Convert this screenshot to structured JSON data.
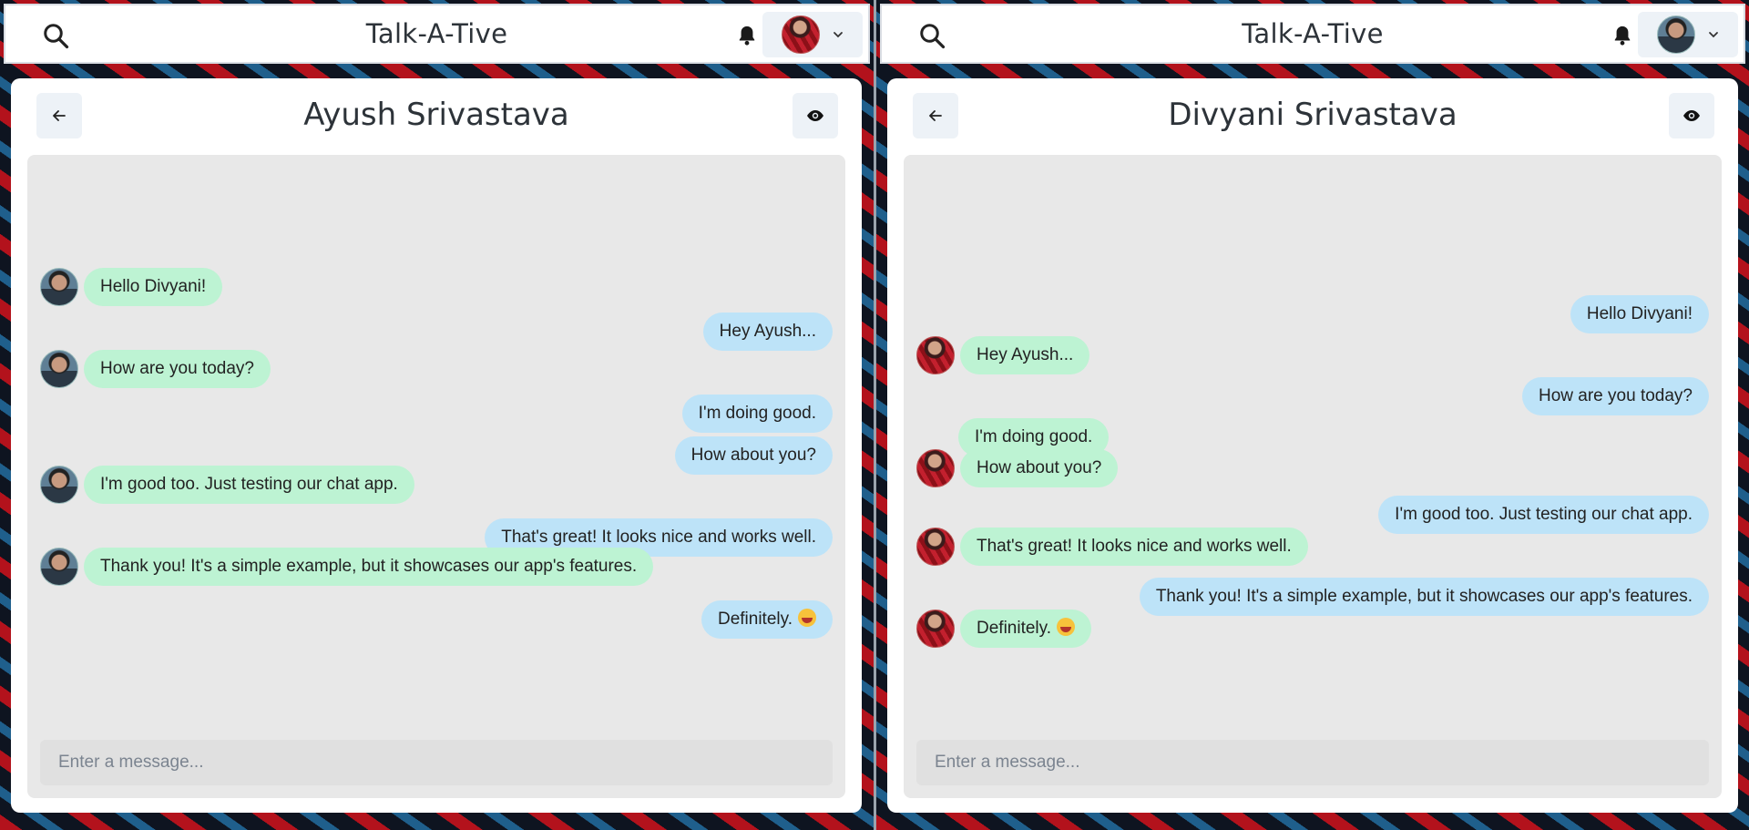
{
  "app_title": "Talk-A-Tive",
  "icons": {
    "search": "search-icon",
    "bell": "bell-icon",
    "chevron": "chevron-down-icon",
    "back": "arrow-left-icon",
    "view": "eye-icon",
    "emoji": "grinning-face-emoji"
  },
  "colors": {
    "received_bubble": "#bdf3d3",
    "sent_bubble": "#bde3f8",
    "chat_background": "#e8e8e8"
  },
  "panes": [
    {
      "chat_name": "Ayush Srivastava",
      "input_placeholder": "Enter a message...",
      "messages": [
        {
          "text": "Hello Divyani!",
          "side": "left",
          "color": "green",
          "avatar": "ayush"
        },
        {
          "text": "Hey Ayush...",
          "side": "right",
          "color": "blue"
        },
        {
          "text": "How are you today?",
          "side": "left",
          "color": "green",
          "avatar": "ayush"
        },
        {
          "text": "I'm doing good.",
          "side": "right",
          "color": "blue"
        },
        {
          "text": "How about you?",
          "side": "right",
          "color": "blue"
        },
        {
          "text": "I'm good too. Just testing our chat app.",
          "side": "left",
          "color": "green",
          "avatar": "ayush"
        },
        {
          "text": "That's great! It looks nice and works well.",
          "side": "right",
          "color": "blue"
        },
        {
          "text": "Thank you! It's a simple example, but it showcases our app's features.",
          "side": "left",
          "color": "green",
          "avatar": "ayush"
        },
        {
          "text": "Definitely.",
          "side": "right",
          "color": "blue",
          "emoji": true
        }
      ]
    },
    {
      "chat_name": "Divyani Srivastava",
      "input_placeholder": "Enter a message...",
      "messages": [
        {
          "text": "Hello Divyani!",
          "side": "right",
          "color": "blue"
        },
        {
          "text": "Hey Ayush...",
          "side": "left",
          "color": "green",
          "avatar": "divyani"
        },
        {
          "text": "How are you today?",
          "side": "right",
          "color": "blue"
        },
        {
          "text": "I'm doing good.",
          "side": "left",
          "color": "green"
        },
        {
          "text": "How about you?",
          "side": "left",
          "color": "green",
          "avatar": "divyani"
        },
        {
          "text": "I'm good too. Just testing our chat app.",
          "side": "right",
          "color": "blue"
        },
        {
          "text": "That's great! It looks nice and works well.",
          "side": "left",
          "color": "green",
          "avatar": "divyani"
        },
        {
          "text": "Thank you! It's a simple example, but it showcases our app's features.",
          "side": "right",
          "color": "blue"
        },
        {
          "text": "Definitely.",
          "side": "left",
          "color": "green",
          "avatar": "divyani",
          "emoji": true
        }
      ]
    }
  ]
}
